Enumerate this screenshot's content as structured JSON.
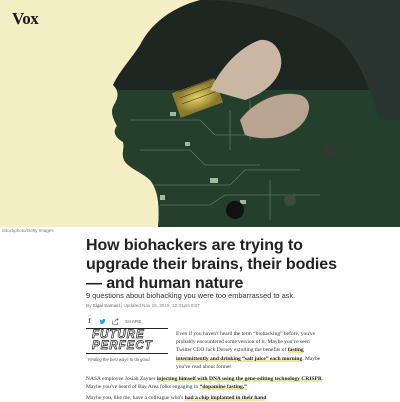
{
  "site": {
    "logo": "Vox"
  },
  "hero": {
    "credit": "iStockphoto/Getty Images"
  },
  "article": {
    "headline": "How biohackers are trying to upgrade their brains, their bodies — and human nature",
    "dek": "9 questions about biohacking you were too embarrassed to ask.",
    "byline": {
      "prefix": "By",
      "author": "Sigal Samuel",
      "separator": "|",
      "updated": "Updated Nov 15, 2019, 12:31pm EST"
    }
  },
  "share": {
    "label": "SHARE"
  },
  "future_perfect": {
    "line1": "FUTURE",
    "line2": "PERFECT",
    "tagline": "Finding the best ways to do good."
  },
  "body": {
    "p1_text1": "Even if you haven't heard the term “biohacking” before, you've probably encountered some version of it. Maybe you've seen Twitter CEO Jack Dorsey extolling the benefits of ",
    "p1_link1": "fasting intermittently and drinking “salt juice” each morning",
    "p1_text2": ". Maybe you've read about former",
    "p1b_text1": "NASA employee Josiah Zayner ",
    "p1b_link1": "injecting himself with DNA using the gene-editing technology CRISPR",
    "p1b_text2": ". Maybe you've heard of Bay Area folks engaging in ",
    "p1b_link2": "“dopamine fasting.”",
    "p2_text1": "Maybe you, like me, have a colleague who's ",
    "p2_link1": "had a chip implanted in their hand"
  },
  "colors": {
    "hero_bg": "#f3eec4",
    "highlight": "#ece7a0",
    "facebook": "#3b5998",
    "twitter": "#1da1f2"
  },
  "icons": [
    "facebook-icon",
    "twitter-icon",
    "share-icon"
  ]
}
